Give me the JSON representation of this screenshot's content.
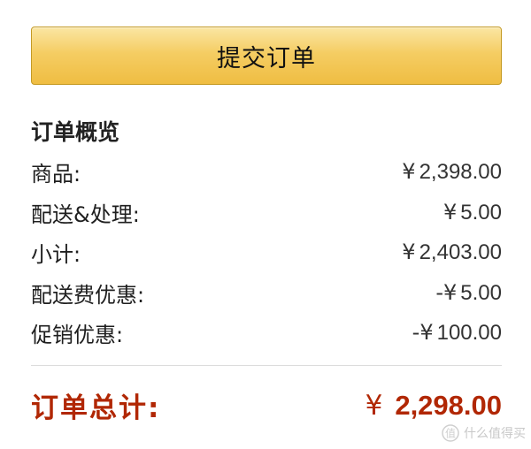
{
  "submit_button": {
    "label": "提交订单"
  },
  "order_summary": {
    "title": "订单概览",
    "rows": [
      {
        "label": "商品:",
        "currency": "¥",
        "value": "2,398.00"
      },
      {
        "label": "配送&处理:",
        "currency": "¥",
        "value": "5.00"
      },
      {
        "label": "小计:",
        "currency": "¥",
        "value": "2,403.00"
      },
      {
        "label": "配送费优惠:",
        "currency": "-¥",
        "value": "5.00"
      },
      {
        "label": "促销优惠:",
        "currency": "-¥",
        "value": "100.00"
      }
    ],
    "total": {
      "label": "订单总计:",
      "currency": "¥",
      "value": "2,298.00"
    }
  },
  "watermark": {
    "text": "什么值得买",
    "icon": "zhi-logo-icon"
  },
  "colors": {
    "button_top": "#fae6a3",
    "button_bottom": "#efbd42",
    "button_border": "#c49a24",
    "total_red": "#b12704",
    "divider": "#dcdcdc"
  }
}
